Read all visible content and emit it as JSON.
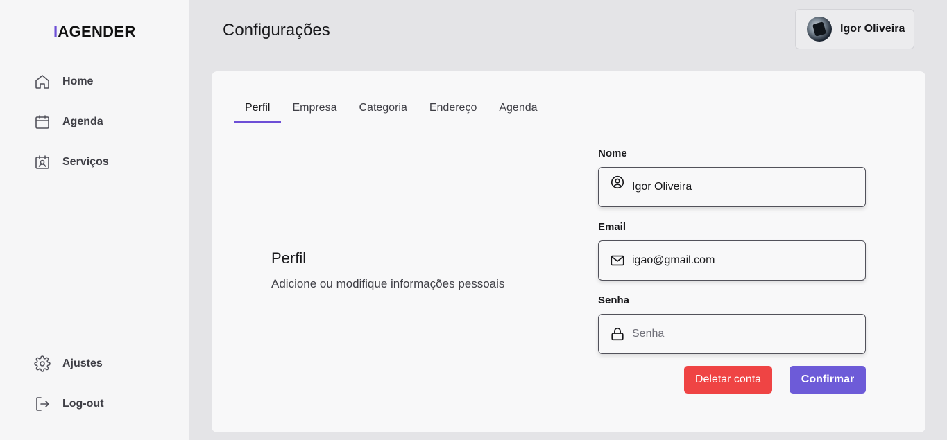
{
  "sidebar": {
    "logo_accent": "I",
    "logo_rest": "AGENDER",
    "nav_top": [
      {
        "label": "Home",
        "icon": "home-icon"
      },
      {
        "label": "Agenda",
        "icon": "calendar-icon"
      },
      {
        "label": "Serviços",
        "icon": "id-badge-icon"
      }
    ],
    "nav_bottom": [
      {
        "label": "Ajustes",
        "icon": "gear-icon"
      },
      {
        "label": "Log-out",
        "icon": "logout-icon"
      }
    ]
  },
  "header": {
    "title": "Configurações",
    "user_name": "Igor Oliveira"
  },
  "tabs": [
    "Perfil",
    "Empresa",
    "Categoria",
    "Endereço",
    "Agenda"
  ],
  "active_tab": "Perfil",
  "section": {
    "title": "Perfil",
    "description": "Adicione ou modifique informações pessoais"
  },
  "form": {
    "name": {
      "label": "Nome",
      "value": "Igor Oliveira",
      "icon": "user-circle-icon"
    },
    "email": {
      "label": "Email",
      "value": "igao@gmail.com",
      "icon": "mail-icon"
    },
    "password": {
      "label": "Senha",
      "value": "",
      "placeholder": "Senha",
      "icon": "lock-icon"
    }
  },
  "actions": {
    "delete_label": "Deletar conta",
    "confirm_label": "Confirmar"
  },
  "colors": {
    "accent": "#6d4fd6",
    "danger": "#ef4444",
    "confirm": "#6d5bd8"
  }
}
